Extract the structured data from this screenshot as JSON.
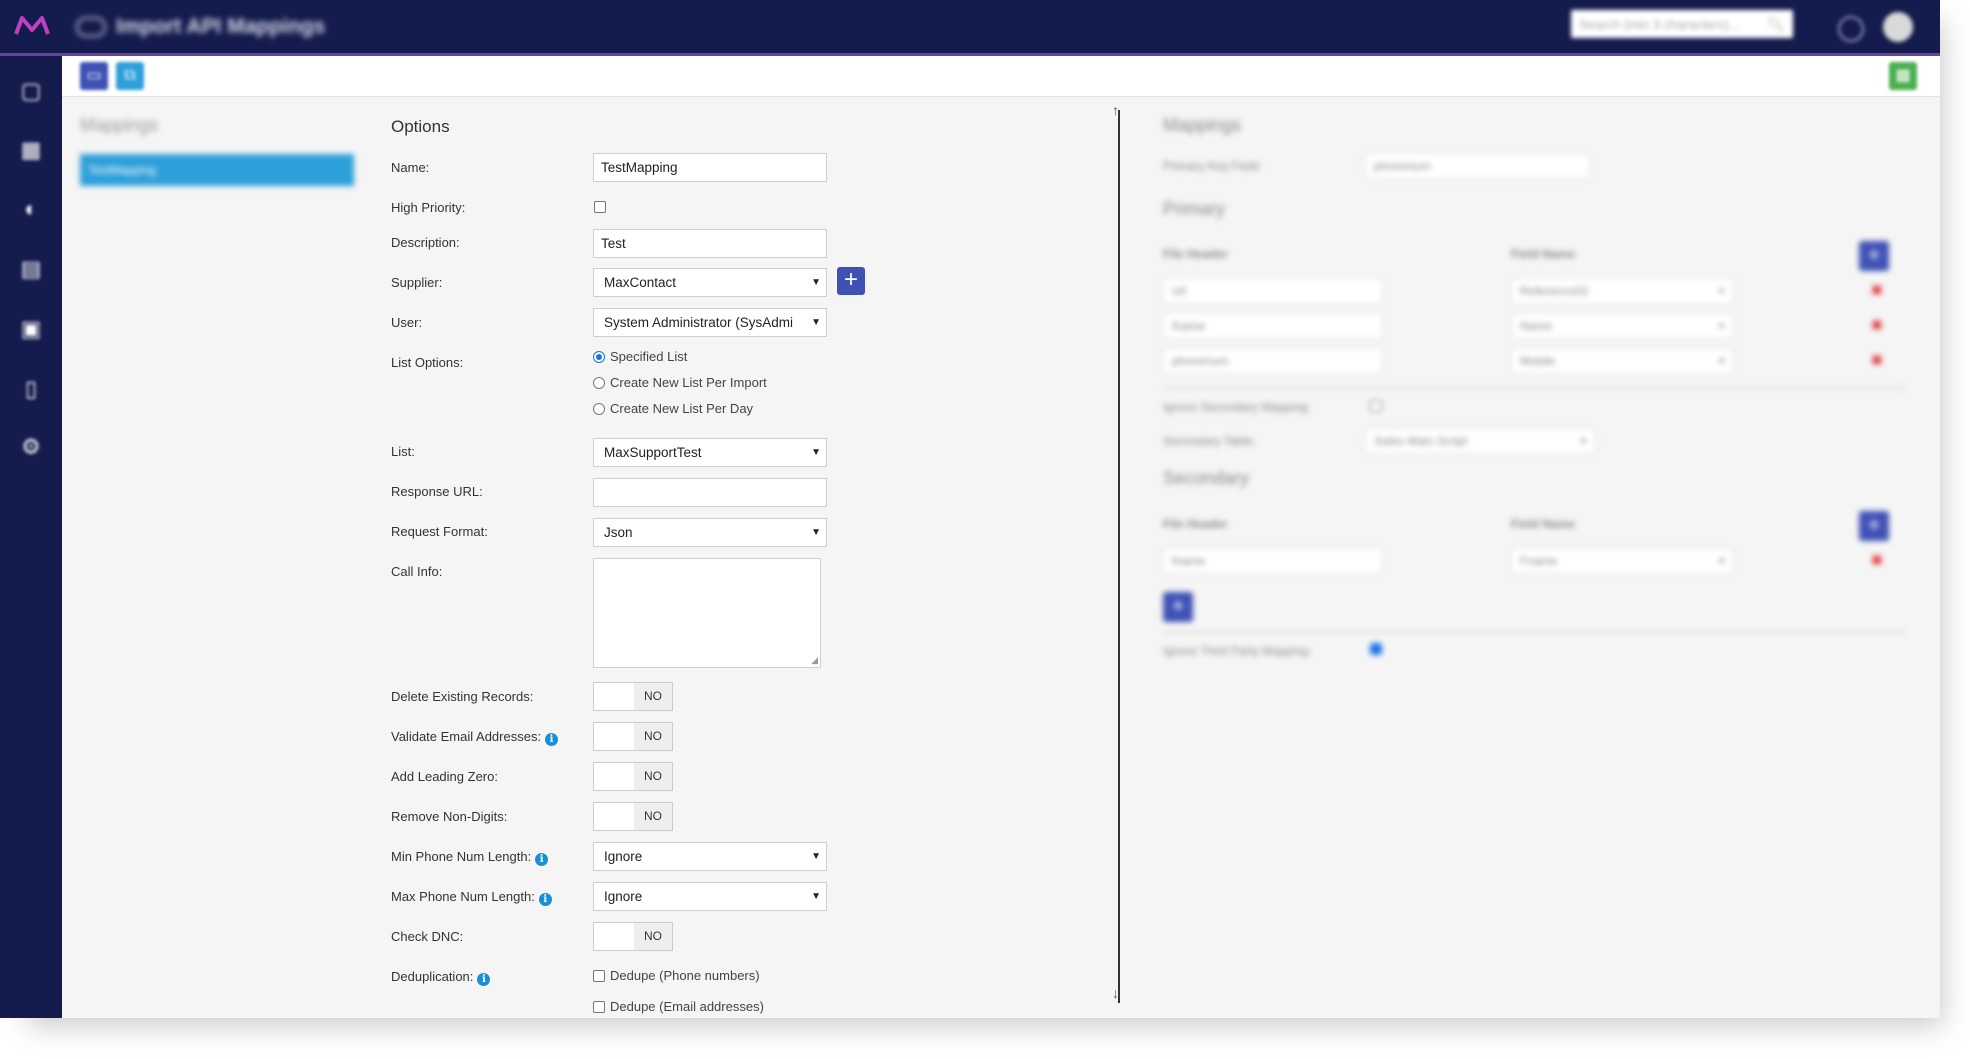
{
  "header": {
    "title": "Import API Mappings",
    "search_placeholder": "Search (min 3 characters)..."
  },
  "mappings_panel": {
    "title": "Mappings",
    "items": [
      "TestMapping"
    ]
  },
  "options": {
    "title": "Options",
    "name": {
      "label": "Name:",
      "value": "TestMapping"
    },
    "high_priority": {
      "label": "High Priority:"
    },
    "description": {
      "label": "Description:",
      "value": "Test"
    },
    "supplier": {
      "label": "Supplier:",
      "value": "MaxContact"
    },
    "user": {
      "label": "User:",
      "value": "System Administrator (SysAdmi"
    },
    "list_options": {
      "label": "List Options:",
      "choices": [
        "Specified List",
        "Create New List Per Import",
        "Create New List Per Day"
      ],
      "selected": "Specified List"
    },
    "list": {
      "label": "List:",
      "value": "MaxSupportTest"
    },
    "response_url": {
      "label": "Response URL:",
      "value": ""
    },
    "request_format": {
      "label": "Request Format:",
      "value": "Json"
    },
    "call_info": {
      "label": "Call Info:",
      "value": ""
    },
    "delete_existing": {
      "label": "Delete Existing Records:",
      "state": "NO"
    },
    "validate_email": {
      "label": "Validate Email Addresses:",
      "state": "NO"
    },
    "add_leading_zero": {
      "label": "Add Leading Zero:",
      "state": "NO"
    },
    "remove_non_digits": {
      "label": "Remove Non-Digits:",
      "state": "NO"
    },
    "min_phone": {
      "label": "Min Phone Num Length:",
      "value": "Ignore"
    },
    "max_phone": {
      "label": "Max Phone Num Length:",
      "value": "Ignore"
    },
    "check_dnc": {
      "label": "Check DNC:",
      "state": "NO"
    },
    "deduplication": {
      "label": "Deduplication:",
      "choices": [
        "Dedupe (Phone numbers)",
        "Dedupe (Email addresses)"
      ]
    }
  },
  "right_panel": {
    "title": "Mappings",
    "primary_key_label": "Primary Key Field:",
    "primary_key_value": "phonenum",
    "primary_title": "Primary",
    "col_file_header": "File Header",
    "col_field_name": "Field Name",
    "primary_rows": [
      {
        "file_header": "ref",
        "field_name": "Reference02"
      },
      {
        "file_header": "fname",
        "field_name": "Name"
      },
      {
        "file_header": "phonenum",
        "field_name": "Mobile"
      }
    ],
    "ignore_secondary_label": "Ignore Secondary Mapping:",
    "secondary_table_label": "Secondary Table:",
    "secondary_table_value": "Sales Main Script",
    "secondary_title": "Secondary",
    "secondary_rows": [
      {
        "file_header": "fname",
        "field_name": "Fname"
      }
    ],
    "ignore_third_party_label": "Ignore Third Party Mapping:"
  },
  "colors": {
    "navy": "#141b4d",
    "accent_purple": "#6b3fa0",
    "primary_button": "#3f51b5",
    "selected_item": "#2d9fd9",
    "save_button": "#4caf50"
  },
  "icons": {
    "sidebar": [
      "home-icon",
      "grid-icon",
      "dashboard-icon",
      "database-icon",
      "contacts-icon",
      "document-icon",
      "settings-icon"
    ],
    "toolbar": [
      "new-document-icon",
      "copy-icon",
      "save-icon"
    ]
  }
}
